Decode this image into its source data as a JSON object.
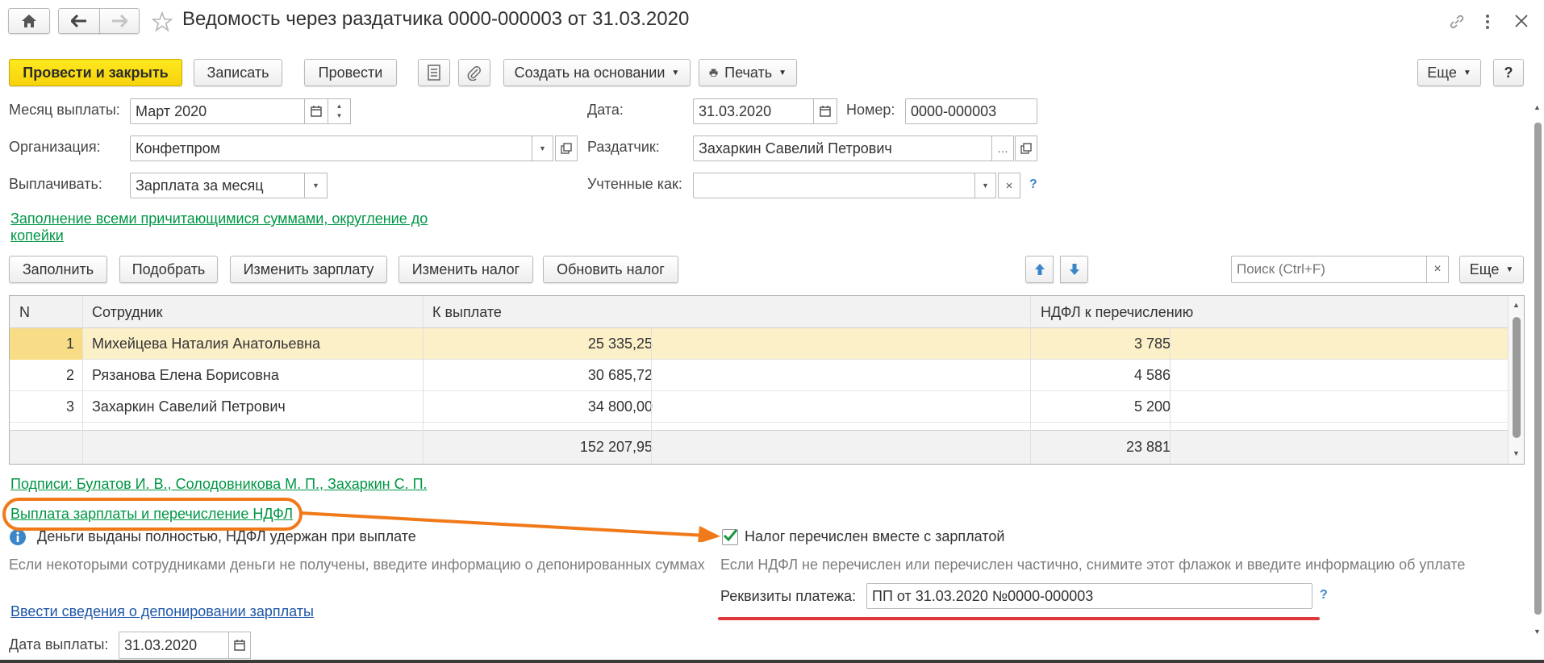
{
  "window": {
    "title": "Ведомость через раздатчика 0000-000003 от 31.03.2020"
  },
  "toolbar": {
    "post_close": "Провести и закрыть",
    "save": "Записать",
    "post": "Провести",
    "create_basis": "Создать на основании",
    "print": "Печать",
    "more": "Еще",
    "help": "?"
  },
  "form": {
    "month_label": "Месяц выплаты:",
    "month_value": "Март 2020",
    "date_label": "Дата:",
    "date_value": "31.03.2020",
    "number_label": "Номер:",
    "number_value": "0000-000003",
    "org_label": "Организация:",
    "org_value": "Конфетпром",
    "distributor_label": "Раздатчик:",
    "distributor_value": "Захаркин Савелий Петрович",
    "pay_label": "Выплачивать:",
    "pay_value": "Зарплата за месяц",
    "counted_label": "Учтенные как:",
    "counted_value": "",
    "counted_help": "?",
    "fill_link_line1": "Заполнение всеми причитающимися суммами, округление до",
    "fill_link_line2": "копейки"
  },
  "table_toolbar": {
    "fill": "Заполнить",
    "pick": "Подобрать",
    "change_salary": "Изменить зарплату",
    "change_tax": "Изменить налог",
    "update_tax": "Обновить налог",
    "search_placeholder": "Поиск (Ctrl+F)",
    "more": "Еще"
  },
  "table": {
    "columns": [
      "N",
      "Сотрудник",
      "К выплате",
      "НДФЛ к перечислению"
    ],
    "rows": [
      {
        "n": "1",
        "employee": "Михейцева Наталия Анатольевна",
        "amount": "25 335,25",
        "tax": "3 785"
      },
      {
        "n": "2",
        "employee": "Рязанова Елена Борисовна",
        "amount": "30 685,72",
        "tax": "4 586"
      },
      {
        "n": "3",
        "employee": "Захаркин Савелий Петрович",
        "amount": "34 800,00",
        "tax": "5 200"
      }
    ],
    "total_amount": "152 207,95",
    "total_tax": "23 881"
  },
  "footer": {
    "signatures_link": "Подписи: Булатов И. В., Солодовникова М. П., Захаркин С. П.",
    "payment_link": "Выплата зарплаты и перечисление НДФЛ",
    "info_text": "Деньги выданы полностью, НДФЛ удержан при выплате",
    "info_hint": "Если некоторыми сотрудниками деньги не получены, введите информацию о депонированных суммах",
    "deposit_link": "Ввести сведения о депонировании зарплаты",
    "pay_date_label": "Дата выплаты:",
    "pay_date_value": "31.03.2020",
    "tax_checkbox_label": "Налог перечислен вместе с зарплатой",
    "tax_hint": "Если НДФЛ не перечислен или перечислен частично, снимите этот флажок и введите информацию об уплате",
    "payment_details_label": "Реквизиты платежа:",
    "payment_details_value": "ПП от 31.03.2020 №0000-000003",
    "payment_help": "?"
  },
  "colors": {
    "primary_button": "#f6d30b",
    "link_green": "#009646",
    "link_blue": "#1d56a8",
    "selected_row": "#fbf0c8",
    "annotation_orange": "#f07a1a",
    "annotation_red": "#e0393b"
  }
}
